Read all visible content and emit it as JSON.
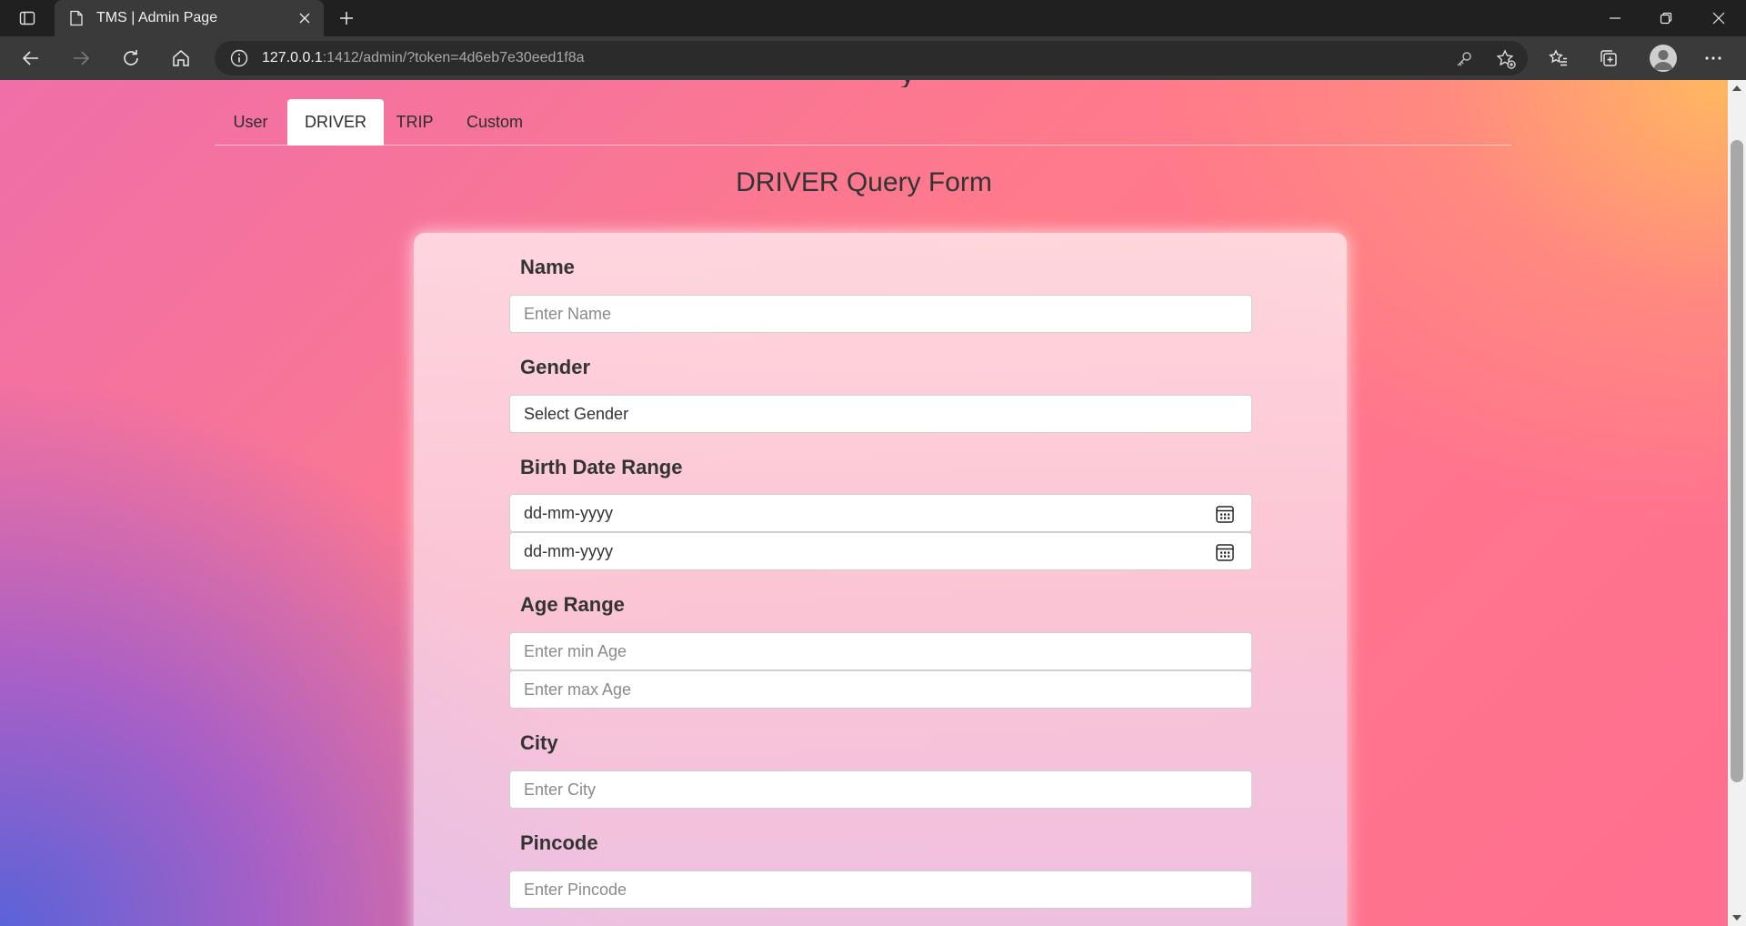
{
  "browser": {
    "tab_title": "TMS | Admin Page",
    "url_host": "127.0.0.1",
    "url_rest": ":1412/admin/?token=4d6eb7e30eed1f8a"
  },
  "page": {
    "nav_tabs": [
      {
        "label": "User",
        "active": false
      },
      {
        "label": "DRIVER",
        "active": true
      },
      {
        "label": "TRIP",
        "active": false
      },
      {
        "label": "Custom",
        "active": false
      }
    ],
    "form_title": "DRIVER Query Form",
    "fields": {
      "name_label": "Name",
      "name_placeholder": "Enter Name",
      "gender_label": "Gender",
      "gender_value": "Select Gender",
      "birth_label": "Birth Date Range",
      "birth_start_placeholder": "dd-mm-yyyy",
      "birth_end_placeholder": "dd-mm-yyyy",
      "age_label": "Age Range",
      "age_min_placeholder": "Enter min Age",
      "age_max_placeholder": "Enter max Age",
      "city_label": "City",
      "city_placeholder": "Enter City",
      "pincode_label": "Pincode",
      "pincode_placeholder": "Enter Pincode"
    }
  },
  "icons": {
    "tab_actions": "tab-actions-icon",
    "favicon": "page-icon",
    "close": "close-icon",
    "new_tab": "plus-icon",
    "back": "back-arrow-icon",
    "forward": "forward-arrow-icon",
    "refresh": "refresh-icon",
    "home": "home-icon",
    "info": "info-icon",
    "key": "key-icon",
    "favorite": "star-add-icon",
    "favorites": "favorites-icon",
    "collections": "collections-icon",
    "profile": "profile-avatar",
    "more": "more-icon",
    "calendar": "calendar-icon"
  }
}
